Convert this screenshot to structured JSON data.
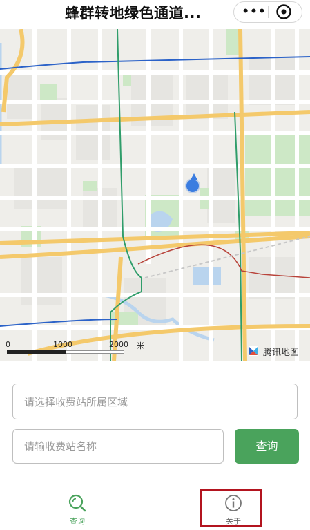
{
  "window": {
    "title": "蜂群转地绿色通道...",
    "more_label": "•••"
  },
  "map": {
    "scale": {
      "zero": "0",
      "mid": "1000",
      "end": "2000",
      "unit": "米"
    },
    "provider": "腾讯地图"
  },
  "form": {
    "region_placeholder": "请选择收费站所属区域",
    "name_placeholder": "请输收费站名称",
    "query_label": "查询"
  },
  "tabs": [
    {
      "label": "查询",
      "icon": "search-icon",
      "active": true
    },
    {
      "label": "关于",
      "icon": "info-icon",
      "active": false
    }
  ],
  "colors": {
    "accent": "#4aa35c",
    "highlight": "#b3141f",
    "location": "#3b7de0"
  }
}
